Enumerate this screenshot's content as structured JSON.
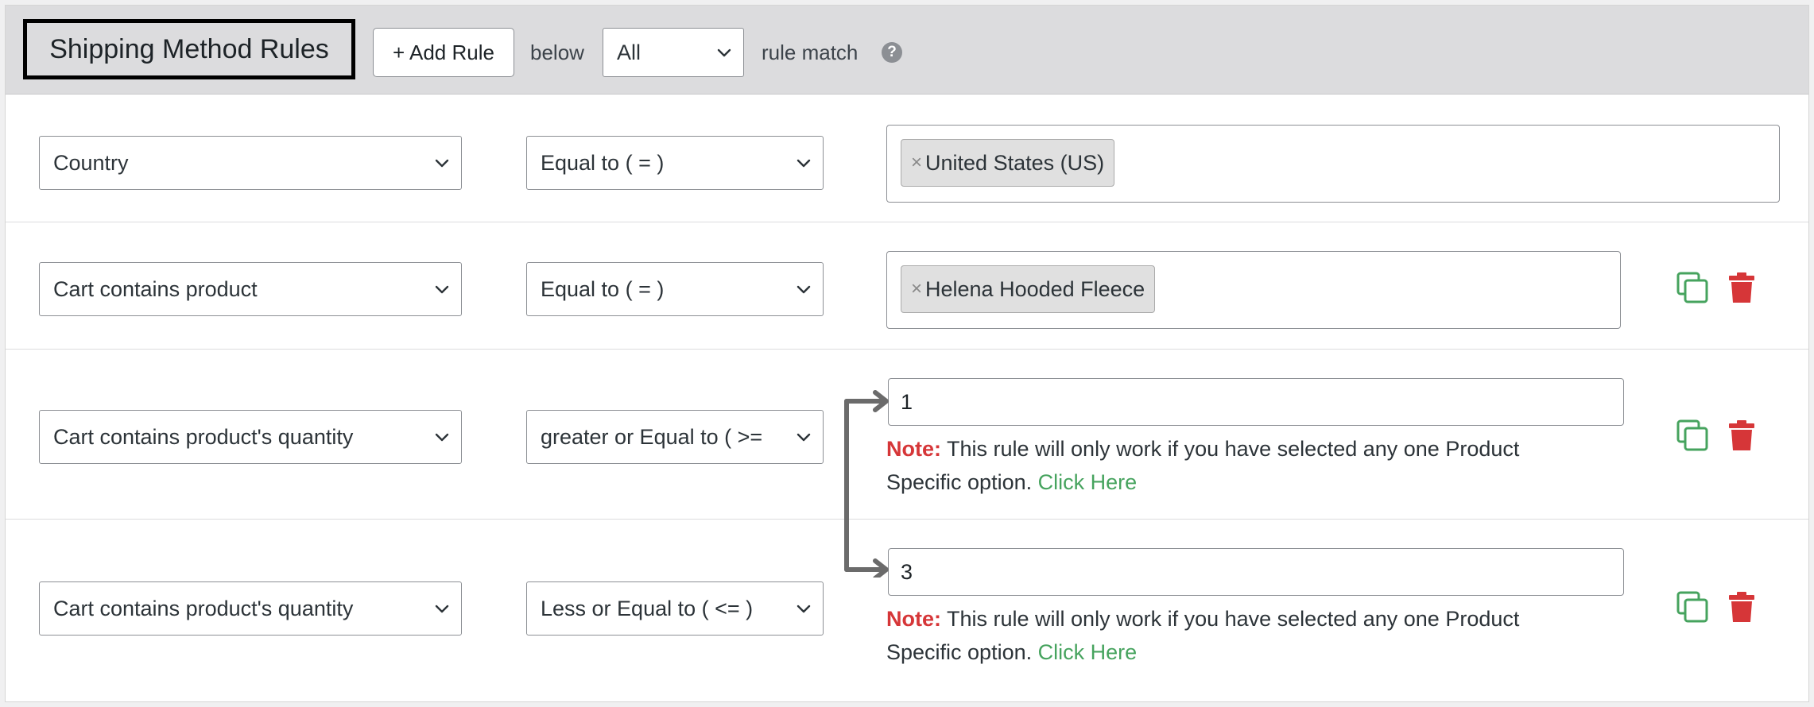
{
  "header": {
    "title": "Shipping Method Rules",
    "add_rule_label": "+ Add Rule",
    "below_label": "below",
    "match_select": "All",
    "rule_match_label": "rule match",
    "help_glyph": "?"
  },
  "rules": [
    {
      "condition": "Country",
      "operator": "Equal to ( = )",
      "tag": "United States (US)",
      "tag_remove": "×"
    },
    {
      "condition": "Cart contains product",
      "operator": "Equal to ( = )",
      "tag": "Helena Hooded Fleece",
      "tag_remove": "×"
    },
    {
      "condition": "Cart contains product's quantity",
      "operator": "greater or Equal to ( >=",
      "value": "1",
      "note_label": "Note:",
      "note_text_1": " This rule will only work if you have selected any one Product",
      "note_text_2": "Specific option. ",
      "note_link": "Click Here"
    },
    {
      "condition": "Cart contains product's quantity",
      "operator": "Less or Equal to ( <= )",
      "value": "3",
      "note_label": "Note:",
      "note_text_1": " This rule will only work if you have selected any one Product",
      "note_text_2": "Specific option. ",
      "note_link": "Click Here"
    }
  ],
  "icons": {
    "dropdown": "chevron-down-icon",
    "duplicate": "duplicate-icon",
    "delete": "trash-icon",
    "connector": "range-connector-arrow"
  },
  "colors": {
    "header_bg": "#dcdcde",
    "note_label": "#d63638",
    "link": "#46a35e",
    "duplicate_icon": "#46a35e",
    "delete_icon": "#d63638",
    "connector": "#6b6b6b"
  }
}
